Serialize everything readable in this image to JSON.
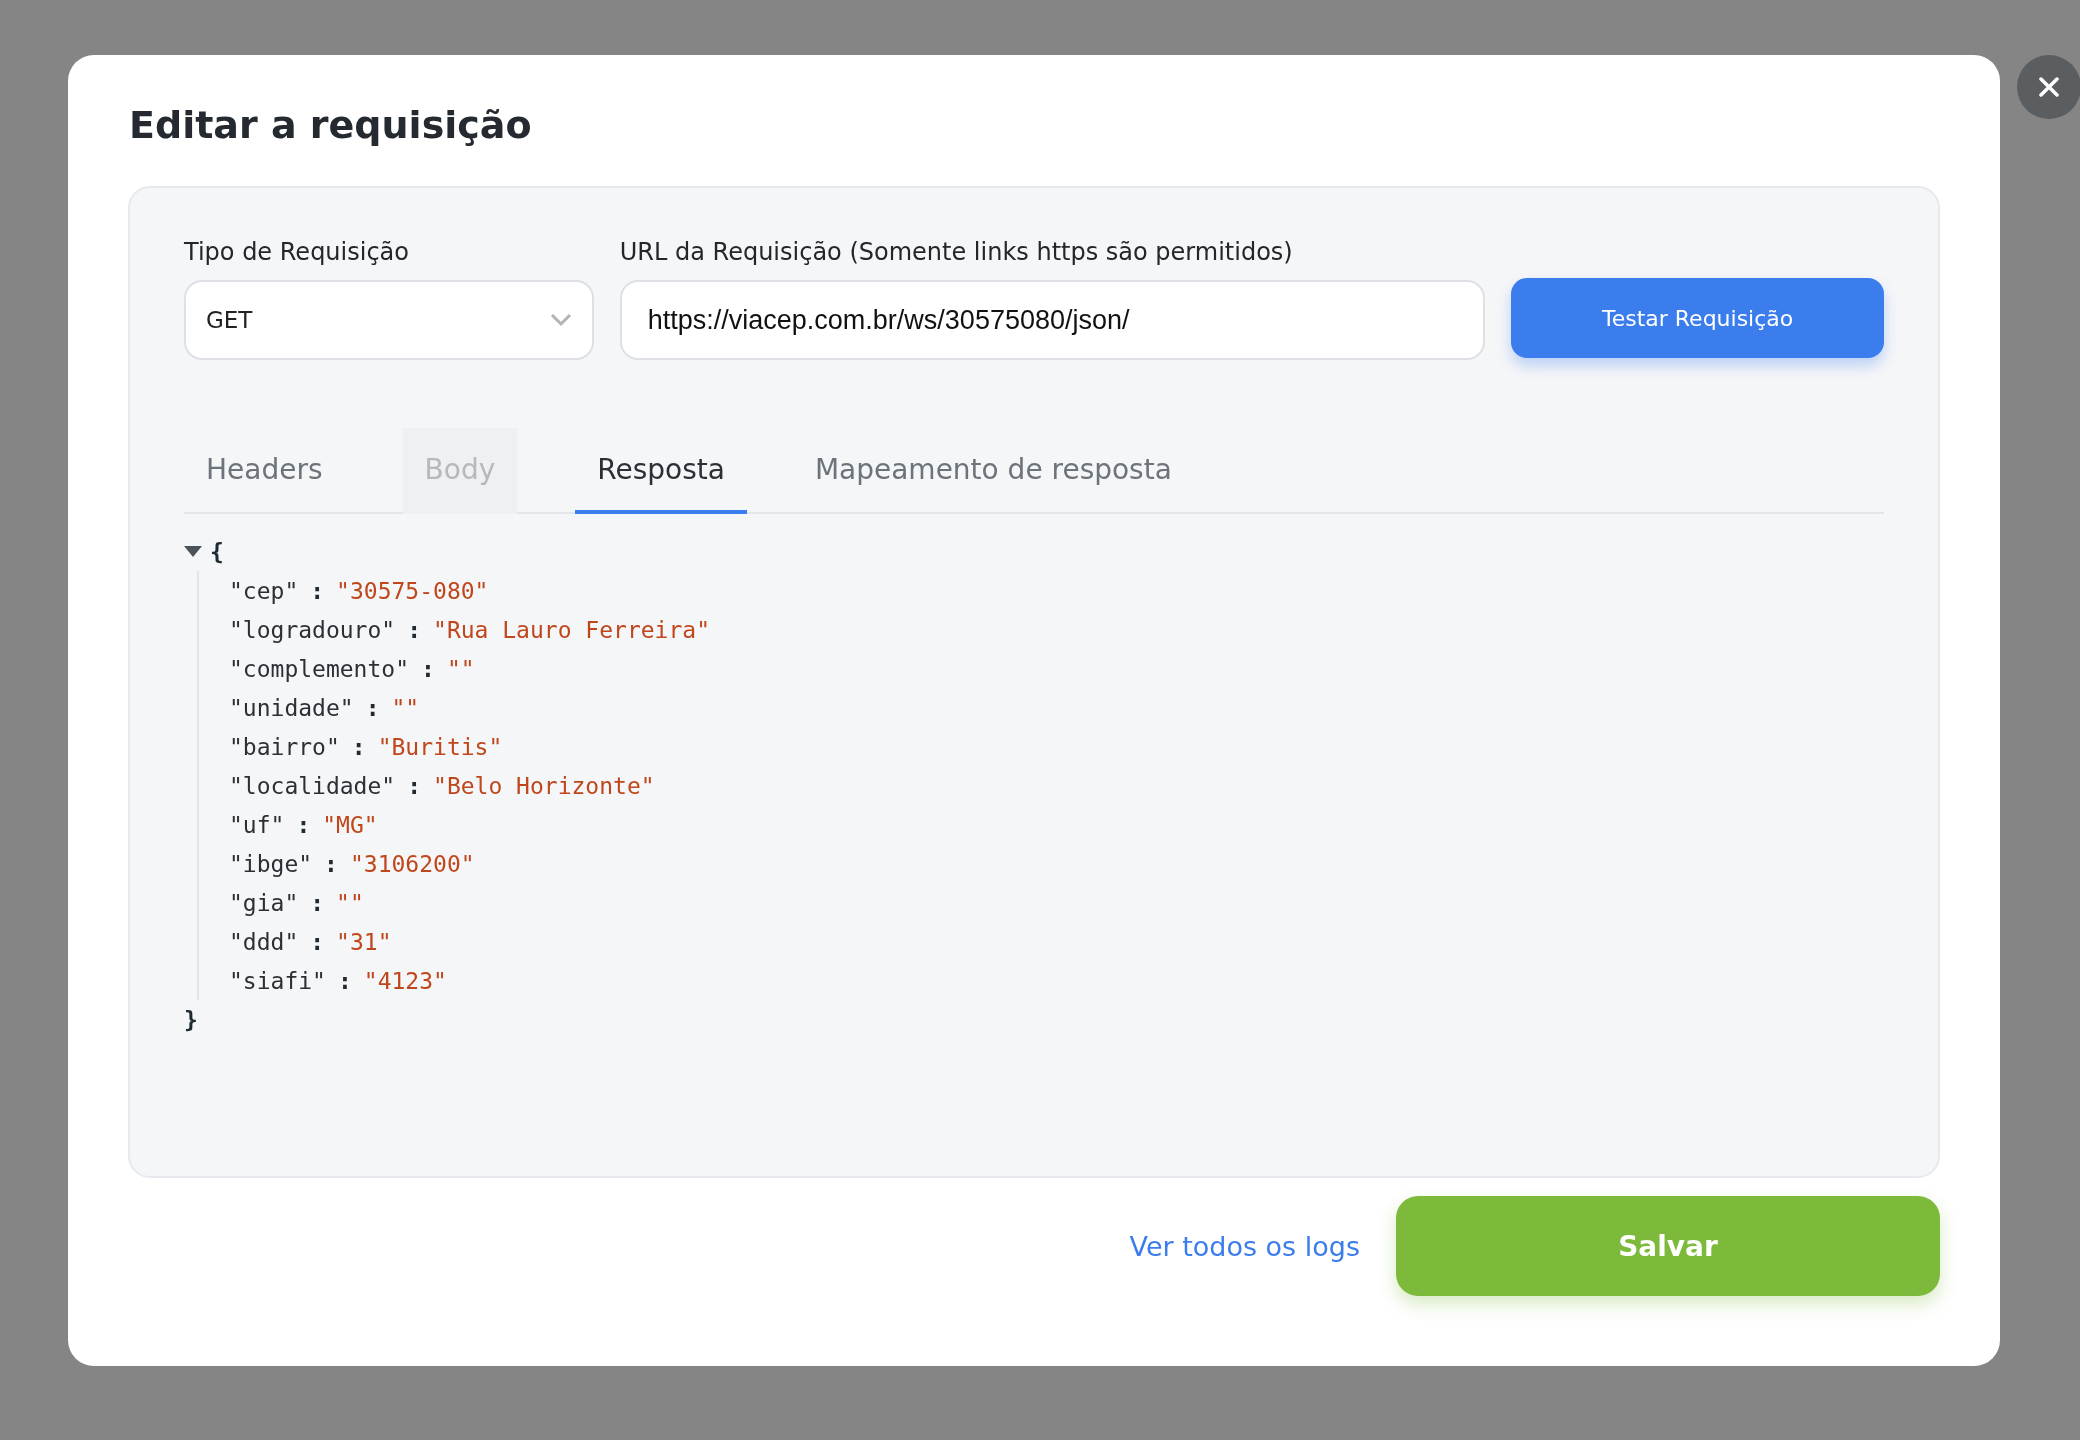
{
  "dialog": {
    "title": "Editar a requisição"
  },
  "request": {
    "type_label": "Tipo de Requisição",
    "type_value": "GET",
    "url_label": "URL da Requisição (Somente links https são permitidos)",
    "url_value": "https://viacep.com.br/ws/30575080/json/",
    "test_button": "Testar Requisição"
  },
  "tabs": [
    {
      "label": "Headers",
      "selected": false,
      "disabled": false
    },
    {
      "label": "Body",
      "selected": false,
      "disabled": true
    },
    {
      "label": "Resposta",
      "selected": true,
      "disabled": false
    },
    {
      "label": "Mapeamento de resposta",
      "selected": false,
      "disabled": false
    }
  ],
  "response": {
    "expanded": true,
    "open": "{",
    "close": "}",
    "entries": [
      {
        "key": "\"cep\"",
        "separator": ":",
        "value": "\"30575-080\""
      },
      {
        "key": "\"logradouro\"",
        "separator": ":",
        "value": "\"Rua Lauro Ferreira\""
      },
      {
        "key": "\"complemento\"",
        "separator": ":",
        "value": "\"\""
      },
      {
        "key": "\"unidade\"",
        "separator": ":",
        "value": "\"\""
      },
      {
        "key": "\"bairro\"",
        "separator": ":",
        "value": "\"Buritis\""
      },
      {
        "key": "\"localidade\"",
        "separator": ":",
        "value": "\"Belo Horizonte\""
      },
      {
        "key": "\"uf\"",
        "separator": ":",
        "value": "\"MG\""
      },
      {
        "key": "\"ibge\"",
        "separator": ":",
        "value": "\"3106200\""
      },
      {
        "key": "\"gia\"",
        "separator": ":",
        "value": "\"\""
      },
      {
        "key": "\"ddd\"",
        "separator": ":",
        "value": "\"31\""
      },
      {
        "key": "\"siafi\"",
        "separator": ":",
        "value": "\"4123\""
      }
    ]
  },
  "footer": {
    "logs_link": "Ver todos os logs",
    "save_button": "Salvar"
  }
}
